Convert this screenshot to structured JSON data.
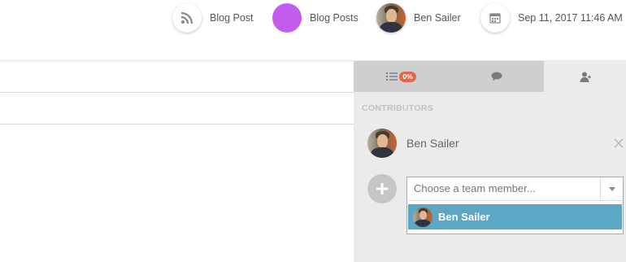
{
  "meta": {
    "content_type": "Blog Post",
    "content_type_icon": "rss-icon",
    "list": "Blog Posts",
    "list_color": "#c45bec",
    "owner": "Ben Sailer",
    "date": "Sep 11, 2017 11:46 AM",
    "date_icon": "calendar-icon"
  },
  "sidebar": {
    "tabs": [
      {
        "name": "tasks",
        "icon": "task-list-icon",
        "badge": "0%"
      },
      {
        "name": "comments",
        "icon": "comment-icon"
      },
      {
        "name": "contributors",
        "icon": "contributors-icon",
        "active": true
      }
    ],
    "section_title": "CONTRIBUTORS",
    "contributors": [
      {
        "name": "Ben Sailer"
      }
    ],
    "picker": {
      "placeholder": "Choose a team member...",
      "options": [
        {
          "name": "Ben Sailer",
          "highlighted": true
        }
      ]
    }
  },
  "colors": {
    "accent": "#5ba7c5",
    "badge": "#e0694a",
    "list_color": "#c45bec"
  }
}
